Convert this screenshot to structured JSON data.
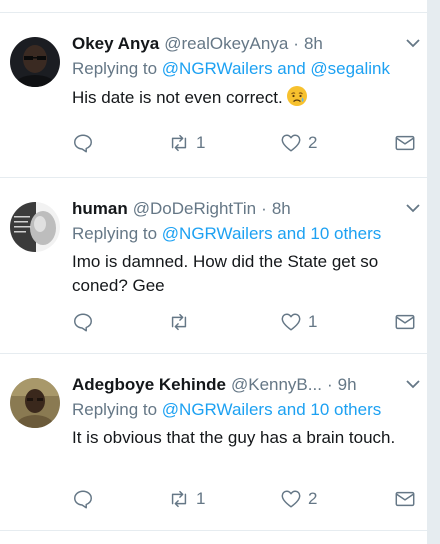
{
  "tweets": [
    {
      "name": "Okey Anya",
      "handle": "@realOkeyAnya",
      "separator": "·",
      "time": "8h",
      "replying_prefix": "Replying to",
      "replying_to": "@NGRWailers and @segalink",
      "text": "His date is not even correct.",
      "emoji": "disappointed-relieved-emoji",
      "retweets": "1",
      "likes": "2"
    },
    {
      "name": "human",
      "handle": "@DoDeRightTin",
      "separator": "·",
      "time": "8h",
      "replying_prefix": "Replying to",
      "replying_to": "@NGRWailers and 10 others",
      "text": "Imo is damned. How did the State get so coned? Gee",
      "retweets": "",
      "likes": "1"
    },
    {
      "name": "Adegboye Kehinde",
      "handle": "@KennyB...",
      "separator": "·",
      "time": "9h",
      "replying_prefix": "Replying to",
      "replying_to": "@NGRWailers and 10 others",
      "text": "It is obvious that the guy has a brain touch.",
      "retweets": "1",
      "likes": "2"
    }
  ],
  "colors": {
    "link": "#1da1f2",
    "muted": "#657786",
    "text": "#14171a",
    "divider": "#e6ecf0"
  }
}
